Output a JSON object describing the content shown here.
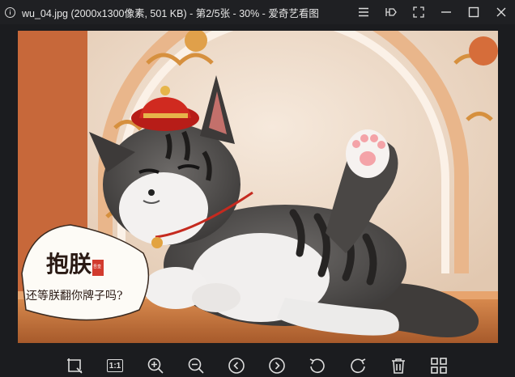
{
  "window": {
    "title": "wu_04.jpg (2000x1300像素, 501 KB) - 第2/5张 - 30% - 爱奇艺看图",
    "controls": [
      "menu-icon",
      "pin-icon",
      "fullscreen-icon",
      "minimize-icon",
      "maximize-icon",
      "close-icon"
    ]
  },
  "image": {
    "file_name": "wu_04.jpg",
    "sign_text_line1": "抱朕",
    "sign_text_line2": "还等朕翻你牌子吗?",
    "sign_stamp": "吾皇"
  },
  "toolbar": {
    "one_to_one_label": "1:1",
    "buttons": [
      "crop-icon",
      "actual-size-icon",
      "zoom-in-icon",
      "zoom-out-icon",
      "previous-icon",
      "next-icon",
      "rotate-left-icon",
      "rotate-right-icon",
      "delete-icon",
      "grid-view-icon"
    ]
  },
  "colors": {
    "background": "#1b1c1f",
    "titlebar": "#1f2023",
    "icon": "#dcdcdc",
    "hat": "#c0281f",
    "wall": "#f3e4d6",
    "floor": "#c97a43"
  }
}
